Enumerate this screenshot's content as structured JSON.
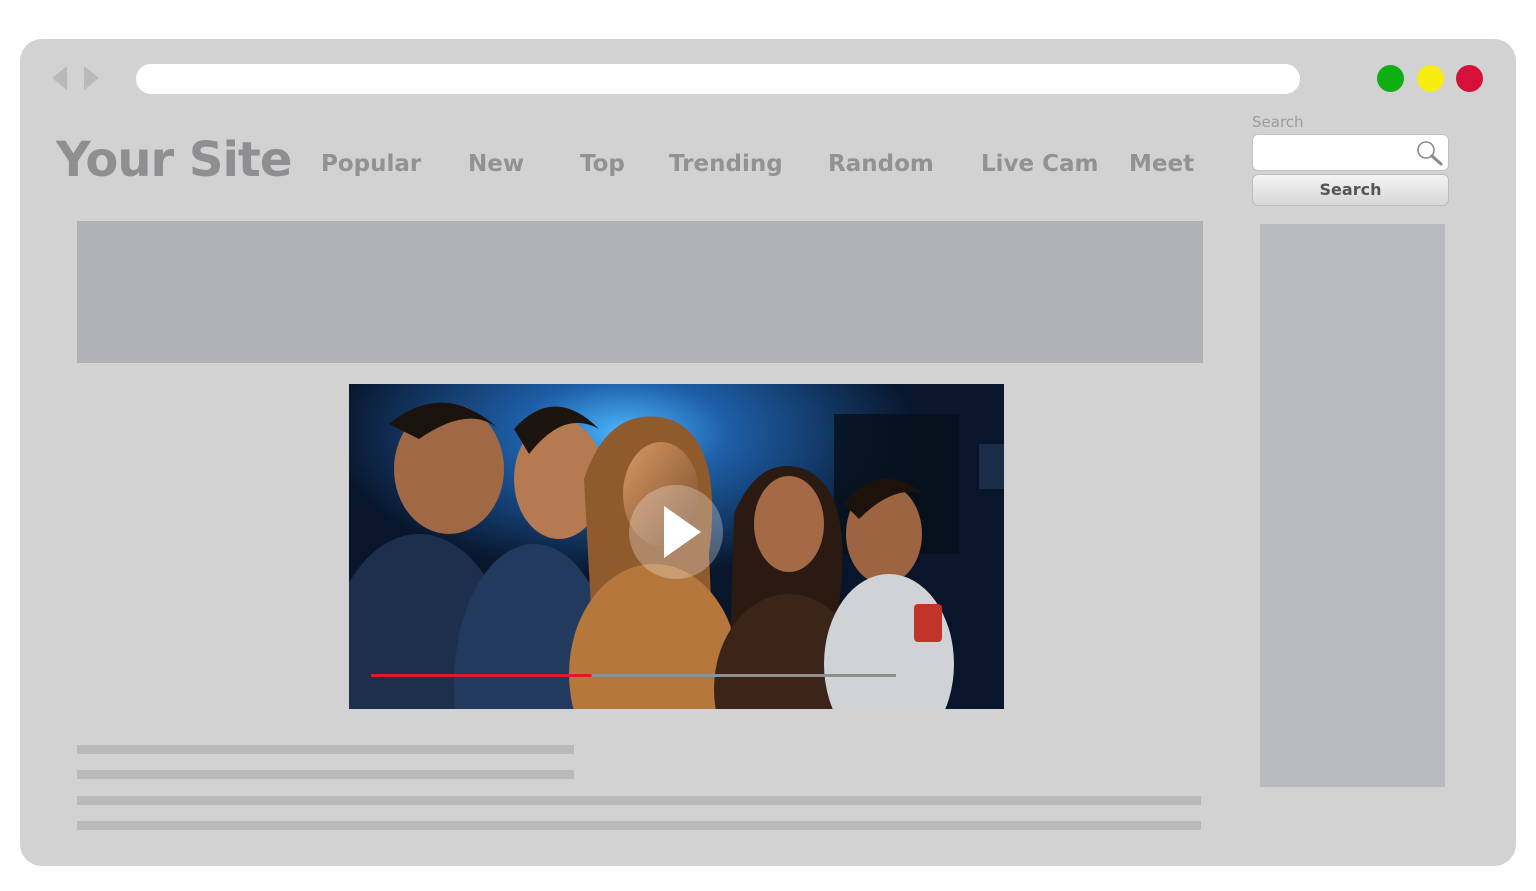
{
  "browser": {
    "back_icon": "triangle-left-icon",
    "forward_icon": "triangle-right-icon",
    "window_controls": [
      {
        "name": "maximize",
        "color": "#0fae13"
      },
      {
        "name": "minimize",
        "color": "#f6ec10"
      },
      {
        "name": "close",
        "color": "#d5113a"
      }
    ]
  },
  "header": {
    "logo": "Your Site",
    "nav": [
      "Popular",
      "New",
      "Top",
      "Trending",
      "Random",
      "Live Cam",
      "Meet"
    ]
  },
  "search": {
    "caption": "Search",
    "input_value": "",
    "button_label": "Search",
    "icon": "magnifier-icon"
  },
  "video": {
    "play_icon": "play-icon",
    "progress": 0.42,
    "progress_color": "#e2162c"
  },
  "colors": {
    "window": "#d2d2d3",
    "placeholder": "#b0b1b4"
  }
}
